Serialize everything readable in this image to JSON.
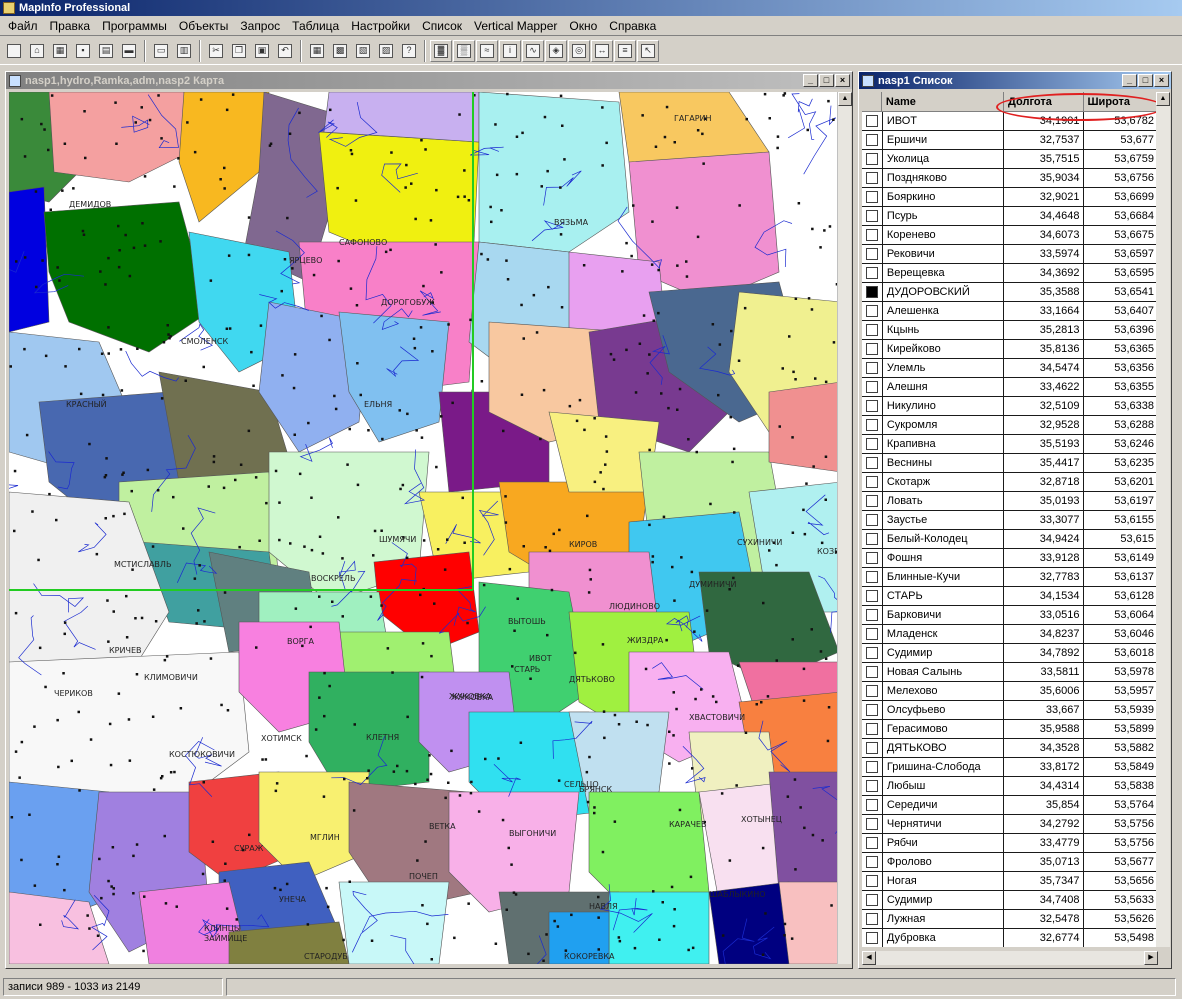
{
  "app": {
    "title": "MapInfo Professional"
  },
  "menu": [
    "Файл",
    "Правка",
    "Программы",
    "Объекты",
    "Запрос",
    "Таблица",
    "Настройки",
    "Список",
    "Vertical Mapper",
    "Окно",
    "Справка"
  ],
  "toolbar": {
    "icons": [
      "new-icon",
      "open-icon",
      "open-workspace-icon",
      "save-icon",
      "save-workspace-icon",
      "folder-icon",
      "print-preview-icon",
      "print-icon",
      "cut-icon",
      "copy-icon",
      "paste-icon",
      "undo-icon",
      "new-browser-icon",
      "new-mapper-icon",
      "new-grapher-icon",
      "new-layout-icon",
      "help-pointer-icon",
      "grid-color-icon",
      "grid-layers-icon",
      "contour-icon",
      "info-tool-icon",
      "profile-icon",
      "region-tool-icon",
      "compass-icon",
      "measure-icon",
      "stack-icon",
      "select-arrow-icon"
    ]
  },
  "map_window": {
    "title": "nasp1,hydro,Ramka,adm,nasp2 Карта",
    "labels": [
      "ДЕМИДОВ",
      "САФОНОВО",
      "ВЯЗЬМА",
      "ГАГАРИН",
      "ЯРЦЕВО",
      "ДОРОГОБУЖ",
      "СМОЛЕНСК",
      "КРАСНЫЙ",
      "ЕЛЬНЯ",
      "КОЗЕЛЬСК",
      "МСТИСЛАВЛЬ",
      "ШУМЯЧИ",
      "ВОСКРЕЛЬ",
      "КИРОВ",
      "ЛЮДИНОВО",
      "СУХИНИЧИ",
      "ДУМИНИЧИ",
      "КРИЧЕВ",
      "ЧЕРИКОВ",
      "КЛИМОВИЧИ",
      "ВОРГА",
      "ЖИЗДРА",
      "ЖУКОВКА",
      "ВЫТОШЬ",
      "ИВОТ",
      "СТАРЬ",
      "ДЯТЬКОВО",
      "ХОТИМСК",
      "КОСТЮКОВИЧИ",
      "КЛЕТНЯ",
      "ЖУКОВКА",
      "ХВАСТОВИЧИ",
      "СУРАЖ",
      "МГЛИН",
      "ПОЧЕП",
      "БРЯНСК",
      "КАРАЧЕВ",
      "ХОТЫНЕЦ",
      "ВЕТКА",
      "УНЕЧА",
      "КЛИНЦЫ",
      "ЗАЙМИЩЕ",
      "СТАРОДУБ",
      "НАВЛЯ",
      "ШАБЛЫКИНО",
      "КОКОРЕВКА",
      "ВЫГОНИЧИ",
      "СЕЛЬЦО"
    ]
  },
  "list_window": {
    "title": "nasp1 Список",
    "columns": [
      "Name",
      "Долгота",
      "Широта"
    ],
    "rows": [
      {
        "name": "ИВОТ",
        "lon": "34,1901",
        "lat": "53,6782",
        "selected": false
      },
      {
        "name": "Ершичи",
        "lon": "32,7537",
        "lat": "53,677",
        "selected": false
      },
      {
        "name": "Уколица",
        "lon": "35,7515",
        "lat": "53,6759",
        "selected": false
      },
      {
        "name": "Поздняково",
        "lon": "35,9034",
        "lat": "53,6756",
        "selected": false
      },
      {
        "name": "Бояркино",
        "lon": "32,9021",
        "lat": "53,6699",
        "selected": false
      },
      {
        "name": "Псурь",
        "lon": "34,4648",
        "lat": "53,6684",
        "selected": false
      },
      {
        "name": "Коренево",
        "lon": "34,6073",
        "lat": "53,6675",
        "selected": false
      },
      {
        "name": "Рековичи",
        "lon": "33,5974",
        "lat": "53,6597",
        "selected": false
      },
      {
        "name": "Верещевка",
        "lon": "34,3692",
        "lat": "53,6595",
        "selected": false
      },
      {
        "name": "ДУДОРОВСКИЙ",
        "lon": "35,3588",
        "lat": "53,6541",
        "selected": true
      },
      {
        "name": "Алешенка",
        "lon": "33,1664",
        "lat": "53,6407",
        "selected": false
      },
      {
        "name": "Кцынь",
        "lon": "35,2813",
        "lat": "53,6396",
        "selected": false
      },
      {
        "name": "Кирейково",
        "lon": "35,8136",
        "lat": "53,6365",
        "selected": false
      },
      {
        "name": "Улемль",
        "lon": "34,5474",
        "lat": "53,6356",
        "selected": false
      },
      {
        "name": "Алешня",
        "lon": "33,4622",
        "lat": "53,6355",
        "selected": false
      },
      {
        "name": "Никулино",
        "lon": "32,5109",
        "lat": "53,6338",
        "selected": false
      },
      {
        "name": "Сукромля",
        "lon": "32,9528",
        "lat": "53,6288",
        "selected": false
      },
      {
        "name": "Крапивна",
        "lon": "35,5193",
        "lat": "53,6246",
        "selected": false
      },
      {
        "name": "Веснины",
        "lon": "35,4417",
        "lat": "53,6235",
        "selected": false
      },
      {
        "name": "Скотарж",
        "lon": "32,8718",
        "lat": "53,6201",
        "selected": false
      },
      {
        "name": "Ловать",
        "lon": "35,0193",
        "lat": "53,6197",
        "selected": false
      },
      {
        "name": "Заустье",
        "lon": "33,3077",
        "lat": "53,6155",
        "selected": false
      },
      {
        "name": "Белый-Колодец",
        "lon": "34,9424",
        "lat": "53,615",
        "selected": false
      },
      {
        "name": "Фошня",
        "lon": "33,9128",
        "lat": "53,6149",
        "selected": false
      },
      {
        "name": "Блинные-Кучи",
        "lon": "32,7783",
        "lat": "53,6137",
        "selected": false
      },
      {
        "name": "СТАРЬ",
        "lon": "34,1534",
        "lat": "53,6128",
        "selected": false
      },
      {
        "name": "Барковичи",
        "lon": "33,0516",
        "lat": "53,6064",
        "selected": false
      },
      {
        "name": "Младенск",
        "lon": "34,8237",
        "lat": "53,6046",
        "selected": false
      },
      {
        "name": "Судимир",
        "lon": "34,7892",
        "lat": "53,6018",
        "selected": false
      },
      {
        "name": "Новая Салынь",
        "lon": "33,5811",
        "lat": "53,5978",
        "selected": false
      },
      {
        "name": "Мелехово",
        "lon": "35,6006",
        "lat": "53,5957",
        "selected": false
      },
      {
        "name": "Олсуфьево",
        "lon": "33,667",
        "lat": "53,5939",
        "selected": false
      },
      {
        "name": "Герасимово",
        "lon": "35,9588",
        "lat": "53,5899",
        "selected": false
      },
      {
        "name": "ДЯТЬКОВО",
        "lon": "34,3528",
        "lat": "53,5882",
        "selected": false
      },
      {
        "name": "Гришина-Слобода",
        "lon": "33,8172",
        "lat": "53,5849",
        "selected": false
      },
      {
        "name": "Любыш",
        "lon": "34,4314",
        "lat": "53,5838",
        "selected": false
      },
      {
        "name": "Середичи",
        "lon": "35,854",
        "lat": "53,5764",
        "selected": false
      },
      {
        "name": "Чернятичи",
        "lon": "34,2792",
        "lat": "53,5756",
        "selected": false
      },
      {
        "name": "Рябчи",
        "lon": "33,4779",
        "lat": "53,5756",
        "selected": false
      },
      {
        "name": "Фролово",
        "lon": "35,0713",
        "lat": "53,5677",
        "selected": false
      },
      {
        "name": "Ногая",
        "lon": "35,7347",
        "lat": "53,5656",
        "selected": false
      },
      {
        "name": "Судимир",
        "lon": "34,7408",
        "lat": "53,5633",
        "selected": false
      },
      {
        "name": "Лужная",
        "lon": "32,5478",
        "lat": "53,5626",
        "selected": false
      },
      {
        "name": "Дубровка",
        "lon": "32,6774",
        "lat": "53,5498",
        "selected": false
      }
    ]
  },
  "status": {
    "records": "записи 989 - 1033 из 2149"
  },
  "colors": {
    "highlight": "#e02020",
    "crosshair": "#22cc22",
    "title_active": "#0a246a"
  }
}
